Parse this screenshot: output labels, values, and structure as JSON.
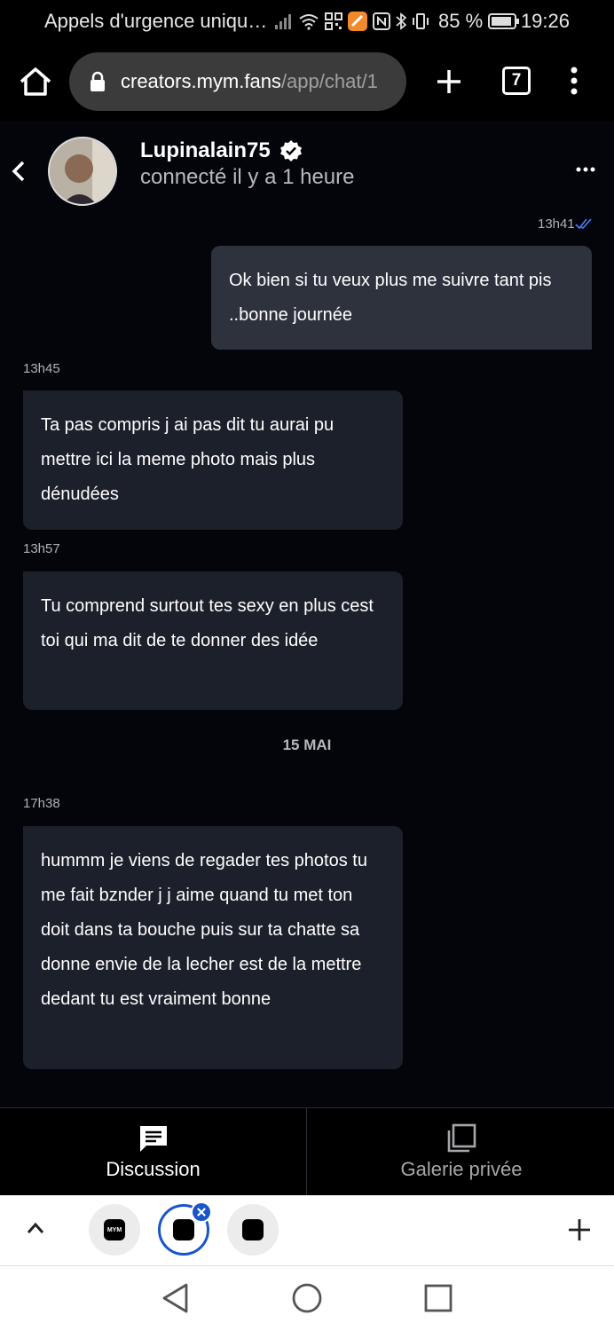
{
  "status_bar": {
    "carrier": "Appels d'urgence uniqu…",
    "battery": "85 %",
    "clock": "19:26"
  },
  "browser": {
    "url_domain": "creators.mym.fans",
    "url_path": "/app/chat/1",
    "tab_count": "7"
  },
  "chat": {
    "username": "Lupinalain75",
    "presence": "connecté il y a 1 heure"
  },
  "messages": [
    {
      "time": "13h41",
      "direction": "out",
      "text": "Ok bien si tu veux plus me suivre tant pis ..bonne journée"
    },
    {
      "time": "13h45",
      "direction": "in",
      "text": "Ta pas compris j ai pas dit tu aurai pu mettre ici la meme photo mais plus dénudées"
    },
    {
      "time": "13h57",
      "direction": "in",
      "text": "Tu comprend surtout tes sexy en plus cest toi qui ma dit de te donner des idée"
    },
    {
      "time": "17h38",
      "direction": "in",
      "text": "hummm je viens de regader tes photos tu me fait bznder j j aime quand tu met ton doit dans ta bouche puis sur ta chatte sa donne envie de la lecher est de la mettre dedant tu est vraiment bonne"
    }
  ],
  "date_separator": "15 MAI",
  "bottom_tabs": {
    "discussion": "Discussion",
    "gallery": "Galerie privée"
  },
  "tab_strip": {
    "tabs": [
      "MYM",
      "MYM",
      "MYM"
    ]
  },
  "colors": {
    "background": "#03050b",
    "bubble_in": "#1c202a",
    "bubble_out": "#2d323d",
    "accent_blue": "#1a56c8"
  }
}
